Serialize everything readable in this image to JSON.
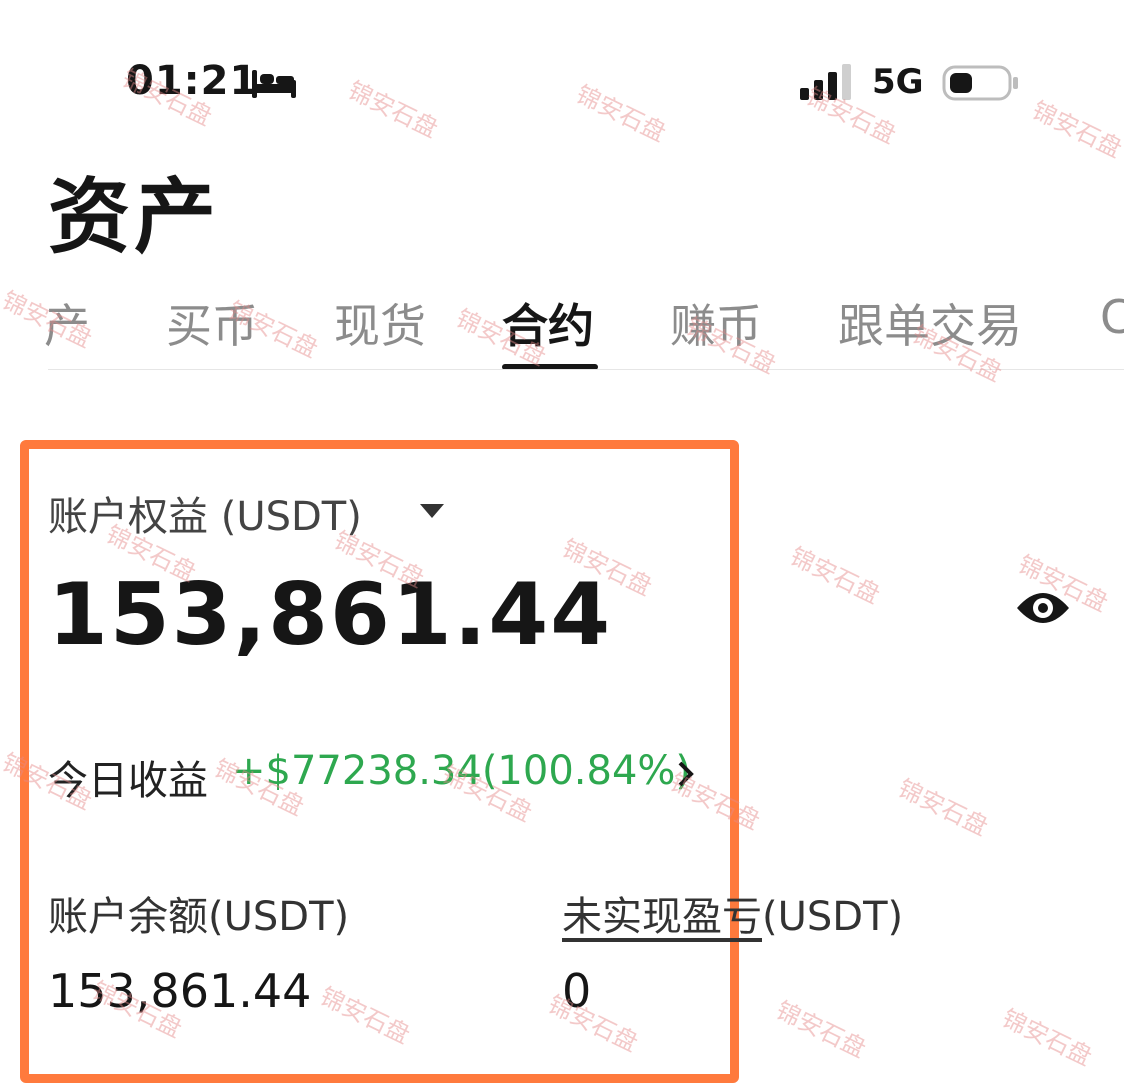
{
  "status_bar": {
    "time": "01:21",
    "network": "5G"
  },
  "page_title": "资产",
  "tabs": [
    "产",
    "买币",
    "现货",
    "合约",
    "赚币",
    "跟单交易",
    "C"
  ],
  "account": {
    "equity_label": "账户权益 (USDT)",
    "equity_value": "153,861.44",
    "today_pnl_label": "今日收益",
    "today_pnl_value": "+$77238.34(100.84%)",
    "balance_label": "账户余额(USDT)",
    "balance_value": "153,861.44",
    "unrealized_label_main": "未实现盈亏",
    "unrealized_label_unit": "(USDT)",
    "unrealized_value": "0"
  },
  "watermark": "锦安石盘",
  "colors": {
    "highlight": "#ff7a3d",
    "positive": "#2ea84f",
    "text": "#161616",
    "muted": "#8c8c8c"
  }
}
